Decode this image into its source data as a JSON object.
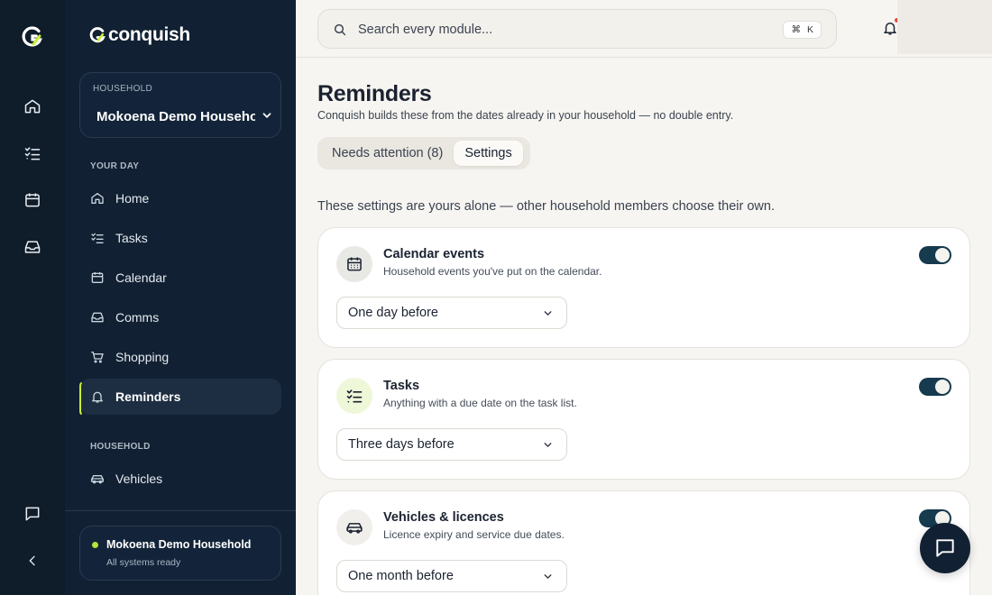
{
  "brand": {
    "name": "conquish"
  },
  "rail": {
    "items": [
      "home-icon",
      "tasks-icon",
      "calendar-icon",
      "inbox-icon"
    ],
    "bottom": [
      "chat-icon",
      "collapse-icon"
    ]
  },
  "sidebar": {
    "household_label": "HOUSEHOLD",
    "household_name": "Mokoena Demo Household",
    "section_your_day": "YOUR DAY",
    "section_household": "HOUSEHOLD",
    "items": [
      {
        "label": "Home",
        "icon": "home-icon"
      },
      {
        "label": "Tasks",
        "icon": "tasks-icon"
      },
      {
        "label": "Calendar",
        "icon": "calendar-icon"
      },
      {
        "label": "Comms",
        "icon": "inbox-icon"
      },
      {
        "label": "Shopping",
        "icon": "cart-icon"
      },
      {
        "label": "Reminders",
        "icon": "bell-icon",
        "active": true
      }
    ],
    "household_items": [
      {
        "label": "Vehicles",
        "icon": "car-icon"
      }
    ],
    "status": {
      "name": "Mokoena Demo Household",
      "sub": "All systems ready",
      "color": "#b9e23a"
    }
  },
  "topbar": {
    "search_placeholder": "Search every module...",
    "shortcut_symbol": "⌘",
    "shortcut_key": "K"
  },
  "page": {
    "title": "Reminders",
    "subtitle": "Conquish builds these from the dates already in your household — no double entry.",
    "tabs": [
      {
        "label": "Needs attention (8)",
        "selected": false
      },
      {
        "label": "Settings",
        "selected": true
      }
    ],
    "intro": "These settings are yours alone — other household members choose their own."
  },
  "cards": [
    {
      "title": "Calendar events",
      "desc": "Household events you've put on the calendar.",
      "icon": "calendar-icon",
      "enabled": true,
      "lead": "One day before",
      "icon_bg": "#e8e8e5"
    },
    {
      "title": "Tasks",
      "desc": "Anything with a due date on the task list.",
      "icon": "checklist-icon",
      "enabled": true,
      "lead": "Three days before",
      "icon_bg": "#eff7d9"
    },
    {
      "title": "Vehicles & licences",
      "desc": "Licence expiry and service due dates.",
      "icon": "car-icon",
      "enabled": true,
      "lead": "One month before",
      "icon_bg": "#f0efec"
    }
  ],
  "colors": {
    "accent": "#c6f135",
    "navy": "#112032",
    "toggle_on": "#163a4e"
  }
}
